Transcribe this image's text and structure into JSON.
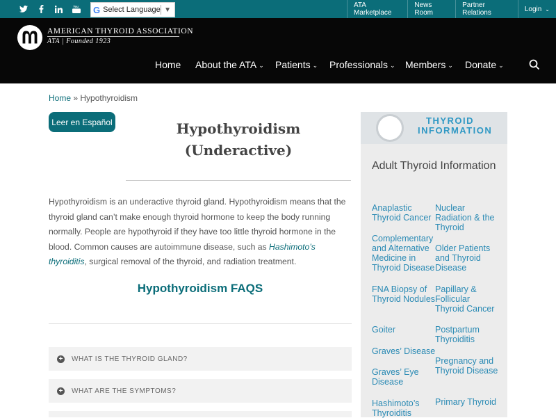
{
  "topbar": {
    "social": [
      "twitter-icon",
      "facebook-icon",
      "linkedin-icon",
      "youtube-icon"
    ],
    "language_label": "Select Language",
    "links": [
      "ATA Marketplace",
      "News Room",
      "Partner Relations",
      "Login"
    ]
  },
  "header": {
    "logo_name": "AMERICAN THYROID ASSOCIATION",
    "logo_sub": "ATA | Founded 1923",
    "nav": [
      {
        "label": "Home"
      },
      {
        "label": "About the ATA"
      },
      {
        "label": "Patients"
      },
      {
        "label": "Professionals"
      },
      {
        "label": "Members"
      },
      {
        "label": "Donate"
      }
    ]
  },
  "breadcrumb": {
    "home": "Home",
    "sep": " » ",
    "current": "Hypothyroidism"
  },
  "spanish_button": "Leer en Español",
  "page_title_line1": "Hypothyroidism",
  "page_title_line2": "(Underactive)",
  "intro": {
    "part1": "Hypothyroidism is an underactive thyroid gland. Hypothyroidism means that the thyroid gland can’t make enough thyroid hormone to keep the body running normally. People are hypothyroid if they have too little thyroid hormone in the blood. Common causes are autoimmune disease, such as ",
    "link": "Hashimoto’s thyroiditis",
    "part2": ", surgical removal of the thyroid, and radiation treatment."
  },
  "faqs_heading": "Hypothyroidism FAQS",
  "faq_items": [
    "WHAT IS THE THYROID GLAND?",
    "WHAT ARE THE SYMPTOMS?"
  ],
  "sidebar": {
    "banner_line1": "THYROID",
    "banner_line2": "INFORMATION",
    "title": "Adult Thyroid Information",
    "col1": [
      "Anaplastic Thyroid Cancer",
      "Complementary and Alternative Medicine in Thyroid Disease",
      "FNA Biopsy of Thyroid Nodules",
      "Goiter",
      "Graves’ Disease",
      "Graves’ Eye Disease",
      "Hashimoto’s Thyroiditis"
    ],
    "col2": [
      "Nuclear Radiation & the Thyroid",
      "Older Patients and Thyroid Disease",
      "Papillary & Follicular Thyroid Cancer",
      "Postpartum Thyroiditis",
      "Pregnancy and Thyroid Disease",
      "Primary Thyroid"
    ]
  },
  "colors": {
    "accent": "#0b6d79",
    "header_bg": "#070707",
    "link": "#2a8ab4"
  }
}
